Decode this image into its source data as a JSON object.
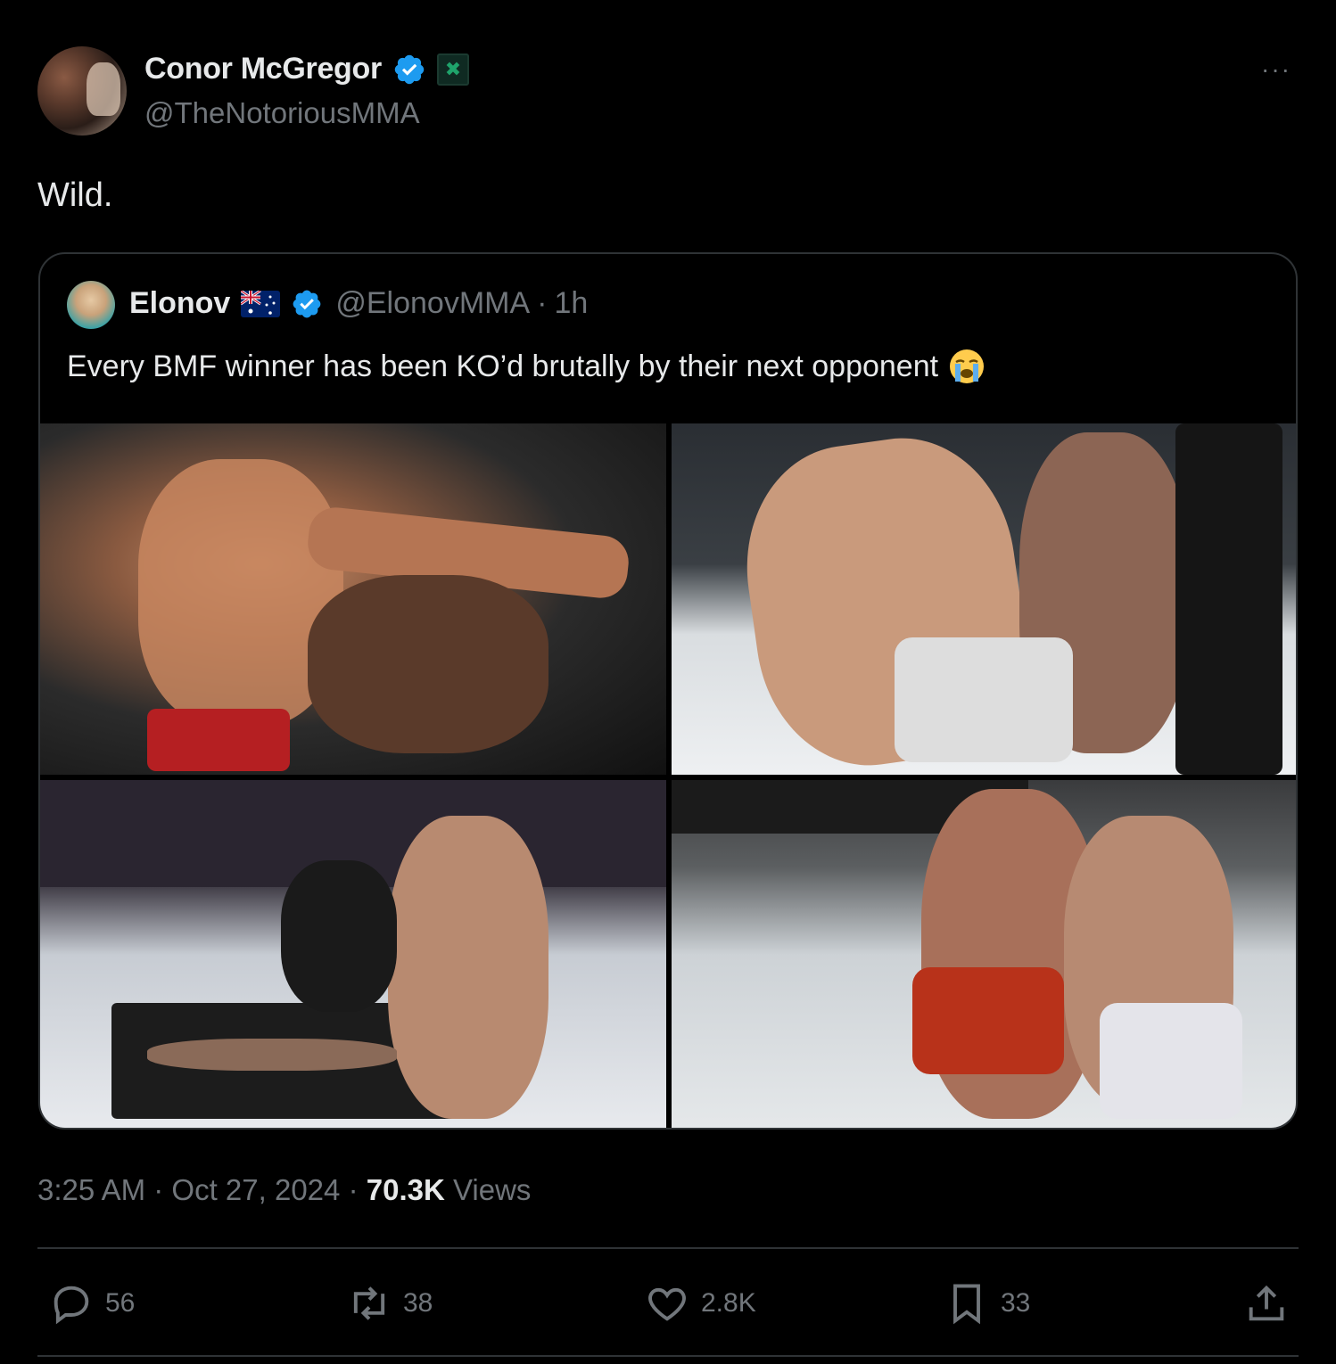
{
  "author": {
    "display_name": "Conor McGregor",
    "handle": "@TheNotoriousMMA",
    "verified_icon": "verified-badge-icon",
    "affiliate_icon": "affiliate-badge-icon",
    "affiliate_glyph": "✖"
  },
  "more_label": "···",
  "tweet_text": "Wild.",
  "quoted_tweet": {
    "display_name": "Elonov",
    "flag_icon": "australia-flag-icon",
    "handle": "@ElonovMMA",
    "time_separator": "·",
    "age": "1h",
    "text": "Every BMF winner has been KO’d brutally by their next opponent",
    "emoji_icon": "loudly-crying-face-icon",
    "photos": [
      "photo-1",
      "photo-2",
      "photo-3",
      "photo-4"
    ]
  },
  "meta": {
    "time": "3:25 AM",
    "sep1": "·",
    "date": "Oct 27, 2024",
    "sep2": "·",
    "views_count": "70.3K",
    "views_label": "Views"
  },
  "actions": {
    "replies": "56",
    "reposts": "38",
    "likes": "2.8K",
    "bookmarks": "33"
  },
  "colors": {
    "background": "#000000",
    "text_primary": "#e7e9ea",
    "text_secondary": "#71767b",
    "border": "#2f3336",
    "verified_blue": "#1d9bf0"
  }
}
